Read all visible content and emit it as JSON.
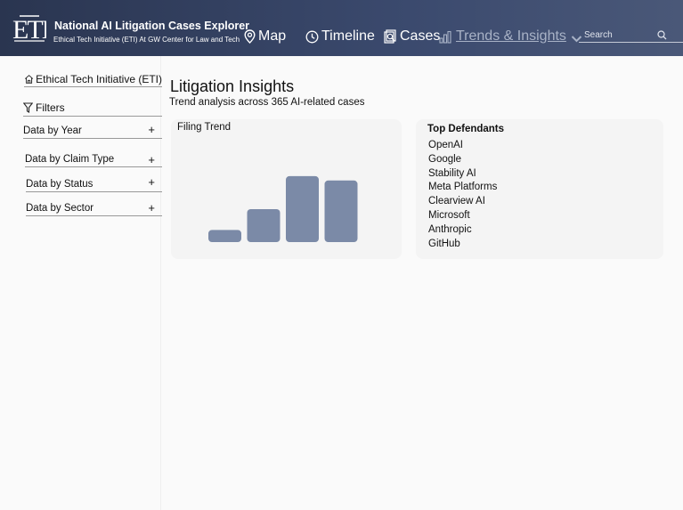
{
  "header": {
    "logo_text": "ETI",
    "title": "National AI Litigation Cases Explorer",
    "subtitle": "Ethical Tech Initiative (ETI) At GW Center for Law and Tech",
    "nav": [
      {
        "label": "Map",
        "icon": "map-pin-icon"
      },
      {
        "label": "Timeline",
        "icon": "clock-icon"
      },
      {
        "label": "Cases",
        "icon": "cases-icon"
      },
      {
        "label": "Trends & Insights",
        "icon": "bar-chart-icon",
        "active": true
      }
    ],
    "search_placeholder": "Search"
  },
  "sidebar": {
    "home_label": "Ethical Tech Initiative (ETI)",
    "filters_label": "Filters",
    "groups": [
      {
        "label": "Data by Year",
        "toggle": "+"
      },
      {
        "label": "Data by Claim Type",
        "toggle": "+"
      },
      {
        "label": "Data by Status",
        "toggle": "+"
      },
      {
        "label": "Data by Sector",
        "toggle": "+"
      }
    ]
  },
  "main": {
    "title": "Litigation Insights",
    "subtitle": "Trend analysis across 365 AI-related cases",
    "trend_card_title": "Filing Trend",
    "defendants_card_title": "Top Defendants",
    "defendants": [
      "OpenAI",
      "Google",
      "Stability AI",
      "Meta Platforms",
      "Clearview AI",
      "Microsoft",
      "Anthropic",
      "GitHub"
    ]
  },
  "colors": {
    "header_start": "#2a3550",
    "header_end": "#4a5878",
    "bar": "#7b8aa7",
    "nav_active": "#a8b2c6"
  },
  "chart_data": {
    "type": "bar",
    "title": "Filing Trend",
    "categories": [
      "",
      "",
      "",
      ""
    ],
    "values": [
      14,
      38,
      76,
      71
    ],
    "ylim": [
      0,
      80
    ],
    "xlabel": "",
    "ylabel": "",
    "grid": false,
    "legend": "none"
  }
}
